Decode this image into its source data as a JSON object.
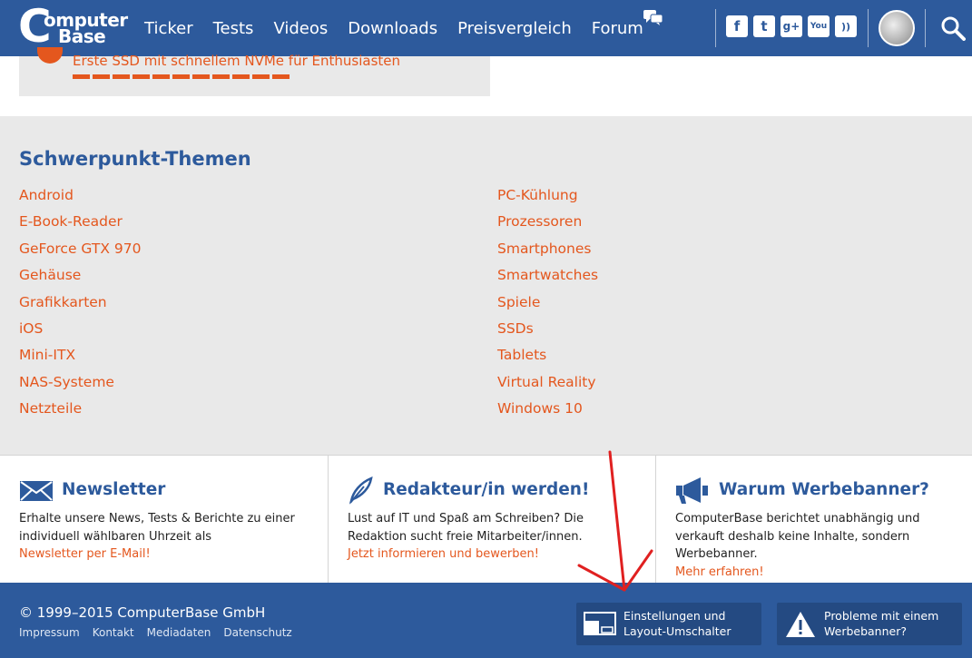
{
  "header": {
    "logo_line1": "C",
    "logo_word1": "omputer",
    "logo_word2": "Base",
    "nav": [
      "Ticker",
      "Tests",
      "Videos",
      "Downloads",
      "Preisvergleich",
      "Forum"
    ],
    "social": [
      {
        "icon": "facebook-icon",
        "glyph": "f"
      },
      {
        "icon": "twitter-icon",
        "glyph": "t"
      },
      {
        "icon": "googleplus-icon",
        "glyph": "g+"
      },
      {
        "icon": "youtube-icon",
        "glyph": "You"
      },
      {
        "icon": "rss-icon",
        "glyph": "))"
      }
    ]
  },
  "top_card": {
    "link": "Erste SSD mit schnellem NVMe für Enthusiasten"
  },
  "topics": {
    "title": "Schwerpunkt-Themen",
    "left": [
      "Android",
      "E-Book-Reader",
      "GeForce GTX 970",
      "Gehäuse",
      "Grafikkarten",
      "iOS",
      "Mini-ITX",
      "NAS-Systeme",
      "Netzteile"
    ],
    "right": [
      "PC-Kühlung",
      "Prozessoren",
      "Smartphones",
      "Smartwatches",
      "Spiele",
      "SSDs",
      "Tablets",
      "Virtual Reality",
      "Windows 10"
    ]
  },
  "info": {
    "newsletter": {
      "title": "Newsletter",
      "text": "Erhalte unsere News, Tests & Berichte zu einer individuell wählbaren Uhrzeit als",
      "link": "Newsletter per E-Mail!"
    },
    "editor": {
      "title": "Redakteur/in werden!",
      "text": "Lust auf IT und Spaß am Schreiben? Die Redaktion sucht freie Mitarbeiter/innen.",
      "link": "Jetzt informieren und bewerben!"
    },
    "ads": {
      "title": "Warum Werbebanner?",
      "text": "ComputerBase berichtet unabhängig und verkauft deshalb keine Inhalte, sondern Werbebanner.",
      "link": "Mehr erfahren!"
    }
  },
  "footer": {
    "copyright": "© 1999–2015 ComputerBase GmbH",
    "links": [
      "Impressum",
      "Kontakt",
      "Mediadaten",
      "Datenschutz"
    ],
    "settings_line1": "Einstellungen und",
    "settings_line2": "Layout-Umschalter",
    "problems_line1": "Probleme mit einem",
    "problems_line2": "Werbebanner?"
  },
  "colors": {
    "brand_blue": "#2d5a9c",
    "accent_orange": "#e4571e",
    "annotation_red": "#e02020"
  }
}
